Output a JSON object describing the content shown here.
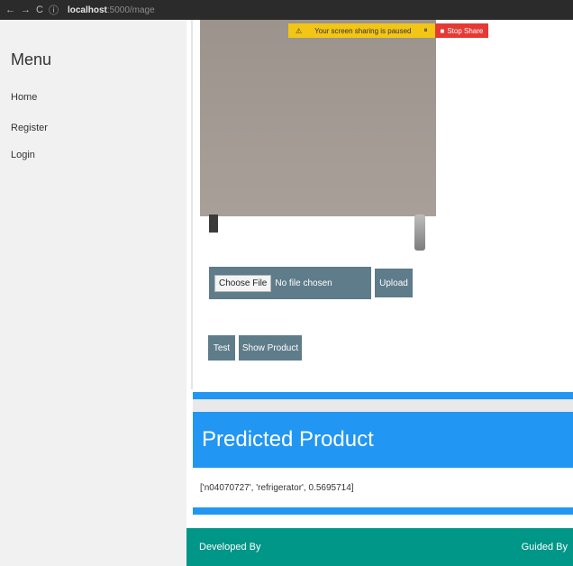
{
  "browser": {
    "back": "←",
    "forward": "→",
    "reload": "C",
    "info": "ⓘ",
    "url_host": "localhost",
    "url_rest": ":5000/mage"
  },
  "share_notice": {
    "message": "Your screen sharing is paused",
    "stop_label": "Stop Share"
  },
  "sidebar": {
    "title": "Menu",
    "items": [
      {
        "label": "Home"
      },
      {
        "label": "Register"
      },
      {
        "label": "Login"
      }
    ]
  },
  "upload": {
    "choose_label": "Choose File",
    "file_status": "No file chosen",
    "upload_label": "Upload"
  },
  "actions": {
    "test_label": "Test",
    "show_label": "Show Product"
  },
  "prediction": {
    "title": "Predicted Product",
    "result": "['n04070727', 'refrigerator', 0.5695714]"
  },
  "footer": {
    "left": "Developed By",
    "right": "Guided By"
  },
  "colors": {
    "accent_blue": "#2196f3",
    "footer_teal": "#009688",
    "button_slate": "#5f7c8a",
    "share_yellow": "#f3c515",
    "share_red": "#e53935"
  }
}
